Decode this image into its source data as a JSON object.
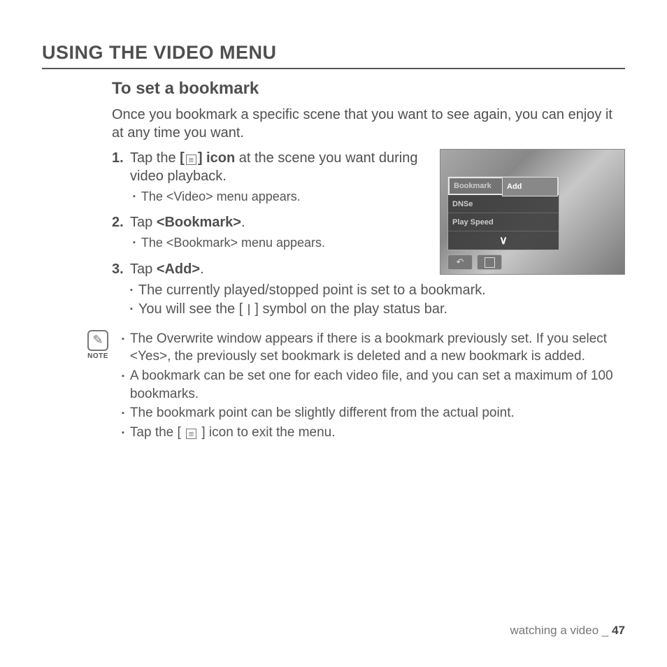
{
  "heading": "USING THE VIDEO MENU",
  "subheading": "To set a bookmark",
  "intro": "Once you bookmark a specific scene that you want to see again, you can enjoy it at any time you want.",
  "step1": {
    "num": "1.",
    "a": "Tap the ",
    "b": "[",
    "c": "] icon",
    "d": " at the scene you want during video playback."
  },
  "step1_sub": "The <Video> menu appears.",
  "step2": {
    "num": "2.",
    "a": "Tap ",
    "b": "<Bookmark>",
    "c": "."
  },
  "step2_sub": "The <Bookmark> menu appears.",
  "step3": {
    "num": "3.",
    "a": "Tap ",
    "b": "<Add>",
    "c": "."
  },
  "step3_sub_a": "The currently played/stopped point is set to a bookmark.",
  "step3_sub_b_a": "You will see the [ ",
  "step3_sub_b_b": " ] symbol on the play status bar.",
  "shot": {
    "bookmark": "Bookmark",
    "add": "Add",
    "dnse": "DNSe",
    "play_speed": "Play Speed"
  },
  "note_label": "NOTE",
  "notes": {
    "n1": "The Overwrite window appears if there is a bookmark previously set. If you select <Yes>, the previously set bookmark is deleted and a new bookmark is added.",
    "n2": "A bookmark can be set one for each video file, and you can set a maximum of 100 bookmarks.",
    "n3": "The bookmark point can be slightly different from the actual point.",
    "n4a": "Tap the [",
    "n4b": "] icon to exit the menu."
  },
  "footer_section": "watching a video _ ",
  "footer_page": "47"
}
